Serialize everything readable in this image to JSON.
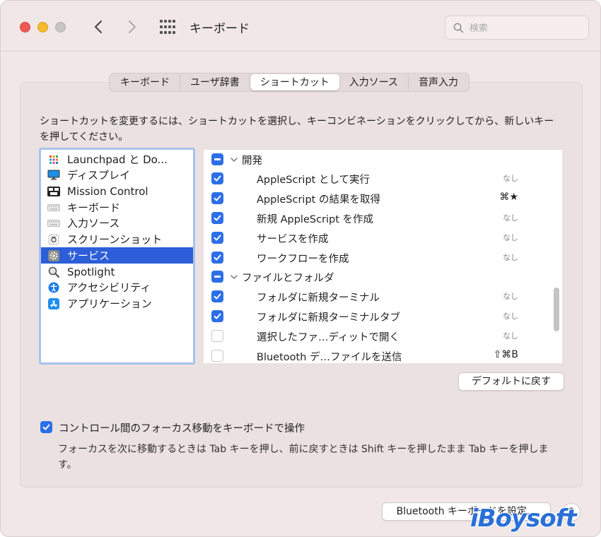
{
  "window": {
    "title": "キーボード",
    "search_placeholder": "検索"
  },
  "tabs": [
    {
      "label": "キーボード",
      "active": false
    },
    {
      "label": "ユーザ辞書",
      "active": false
    },
    {
      "label": "ショートカット",
      "active": true
    },
    {
      "label": "入力ソース",
      "active": false
    },
    {
      "label": "音声入力",
      "active": false
    }
  ],
  "instructions": "ショートカットを変更するには、ショートカットを選択し、キーコンビネーションをクリックしてから、新しいキーを押してください。",
  "categories": [
    {
      "label": "Launchpad と Do...",
      "icon": "launchpad-icon",
      "selected": false
    },
    {
      "label": "ディスプレイ",
      "icon": "display-icon",
      "selected": false
    },
    {
      "label": "Mission Control",
      "icon": "mission-control-icon",
      "selected": false
    },
    {
      "label": "キーボード",
      "icon": "keyboard-icon",
      "selected": false
    },
    {
      "label": "入力ソース",
      "icon": "input-source-icon",
      "selected": false
    },
    {
      "label": "スクリーンショット",
      "icon": "screenshot-icon",
      "selected": false
    },
    {
      "label": "サービス",
      "icon": "gear-icon",
      "selected": true
    },
    {
      "label": "Spotlight",
      "icon": "spotlight-icon",
      "selected": false
    },
    {
      "label": "アクセシビリティ",
      "icon": "accessibility-icon",
      "selected": false
    },
    {
      "label": "アプリケーション",
      "icon": "app-store-icon",
      "selected": false
    }
  ],
  "shortcuts": [
    {
      "type": "group",
      "label": "開発",
      "state": "mixed"
    },
    {
      "type": "item",
      "label": "AppleScript として実行",
      "state": "on",
      "shortcut": "なし"
    },
    {
      "type": "item",
      "label": "AppleScript の結果を取得",
      "state": "on",
      "shortcut": "⌘★"
    },
    {
      "type": "item",
      "label": "新規 AppleScript を作成",
      "state": "on",
      "shortcut": "なし"
    },
    {
      "type": "item",
      "label": "サービスを作成",
      "state": "on",
      "shortcut": "なし"
    },
    {
      "type": "item",
      "label": "ワークフローを作成",
      "state": "on",
      "shortcut": "なし"
    },
    {
      "type": "group",
      "label": "ファイルとフォルダ",
      "state": "mixed"
    },
    {
      "type": "item",
      "label": "フォルダに新規ターミナル",
      "state": "on",
      "shortcut": "なし"
    },
    {
      "type": "item",
      "label": "フォルダに新規ターミナルタブ",
      "state": "on",
      "shortcut": "なし"
    },
    {
      "type": "item",
      "label": "選択したファ…ディットで開く",
      "state": "off",
      "shortcut": "なし"
    },
    {
      "type": "item",
      "label": "Bluetooth デ…ファイルを送信",
      "state": "off",
      "shortcut": "⇧⌘B"
    }
  ],
  "buttons": {
    "restore_defaults": "デフォルトに戻す",
    "bluetooth_keyboard": "Bluetooth キーボードを設定...",
    "help": "?"
  },
  "focus_option": {
    "label": "コントロール間のフォーカス移動をキーボードで操作",
    "checked": true,
    "description": "フォーカスを次に移動するときは Tab キーを押し、前に戻すときは Shift キーを押したまま Tab キーを押します。"
  },
  "watermark": "iBoysoft",
  "colors": {
    "accent": "#2c6fe8",
    "selection": "#2c5ed8",
    "window_bg": "#f1e7e7"
  }
}
